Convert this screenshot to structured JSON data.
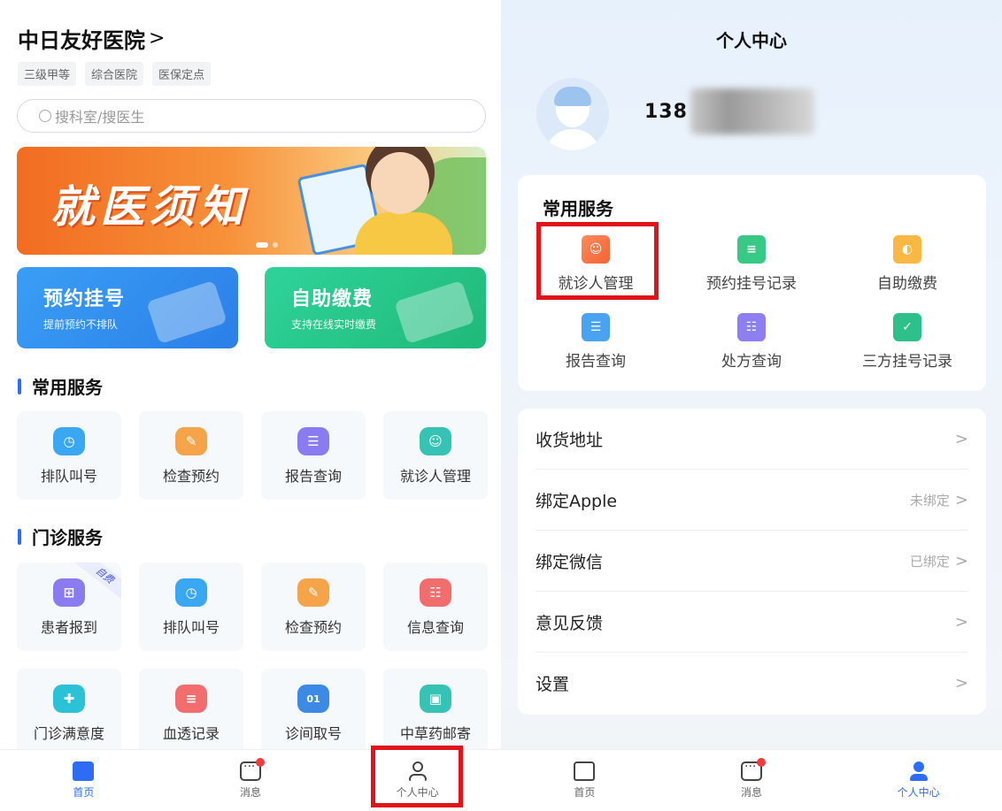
{
  "left": {
    "hospital_name": "中日友好医院",
    "hospital_chevron": ">",
    "tags": [
      "三级甲等",
      "综合医院",
      "医保定点"
    ],
    "search_placeholder": "搜科室/搜医生",
    "banner_text": "就医须知",
    "big_cards": [
      {
        "title": "预约挂号",
        "subtitle": "提前预约不排队"
      },
      {
        "title": "自助缴费",
        "subtitle": "支持在线实时缴费"
      }
    ],
    "common_services_title": "常用服务",
    "common_services": [
      {
        "label": "排队叫号",
        "icon": "clock-icon",
        "color": "#39a7f2"
      },
      {
        "label": "检查预约",
        "icon": "check-icon",
        "color": "#f6a44a"
      },
      {
        "label": "报告查询",
        "icon": "report-icon",
        "color": "#8a7cf0"
      },
      {
        "label": "就诊人管理",
        "icon": "patient-icon",
        "color": "#36c2b4"
      }
    ],
    "outpatient_title": "门诊服务",
    "outpatient_services": [
      {
        "label": "患者报到",
        "icon": "checkin-icon",
        "color": "#8a7cf0",
        "badge": "自费"
      },
      {
        "label": "排队叫号",
        "icon": "clock-icon",
        "color": "#39a7f2"
      },
      {
        "label": "检查预约",
        "icon": "check-icon",
        "color": "#f6a44a"
      },
      {
        "label": "信息查询",
        "icon": "info-icon",
        "color": "#f26d6d"
      },
      {
        "label": "门诊满意度",
        "icon": "plus-icon",
        "color": "#2bc2d8"
      },
      {
        "label": "血透记录",
        "icon": "record-icon",
        "color": "#f26d6d"
      },
      {
        "label": "诊间取号",
        "icon": "ticket-icon",
        "color": "#3d8ae6"
      },
      {
        "label": "中草药邮寄",
        "icon": "box-icon",
        "color": "#36c2b4"
      }
    ],
    "ticket_icon_text": "01",
    "tabs": [
      {
        "label": "首页",
        "icon": "home-icon"
      },
      {
        "label": "消息",
        "icon": "message-icon"
      },
      {
        "label": "个人中心",
        "icon": "user-icon"
      }
    ]
  },
  "right": {
    "page_title": "个人中心",
    "phone_prefix": "138",
    "common_services_title": "常用服务",
    "services": [
      {
        "label": "就诊人管理",
        "icon": "patient-manage-icon",
        "color": "#f26433"
      },
      {
        "label": "预约挂号记录",
        "icon": "appointment-record-icon",
        "color": "#38c987"
      },
      {
        "label": "自助缴费",
        "icon": "wallet-icon",
        "color": "#f9b844"
      },
      {
        "label": "报告查询",
        "icon": "report-search-icon",
        "color": "#4aa3f0"
      },
      {
        "label": "处方查询",
        "icon": "prescription-icon",
        "color": "#8e7ff0"
      },
      {
        "label": "三方挂号记录",
        "icon": "third-party-record-icon",
        "color": "#2ec08a"
      }
    ],
    "settings_rows": [
      {
        "label": "收货地址",
        "value": ""
      },
      {
        "label": "绑定Apple",
        "value": "未绑定"
      },
      {
        "label": "绑定微信",
        "value": "已绑定"
      },
      {
        "label": "意见反馈",
        "value": ""
      },
      {
        "label": "设置",
        "value": ""
      }
    ],
    "row_chevron": ">",
    "tabs": [
      {
        "label": "首页",
        "icon": "home-icon"
      },
      {
        "label": "消息",
        "icon": "message-icon"
      },
      {
        "label": "个人中心",
        "icon": "user-icon"
      }
    ]
  },
  "colors": {
    "primary": "#2d6df6",
    "highlight_box": "#e1141b",
    "notification_dot": "#f23b3b"
  }
}
